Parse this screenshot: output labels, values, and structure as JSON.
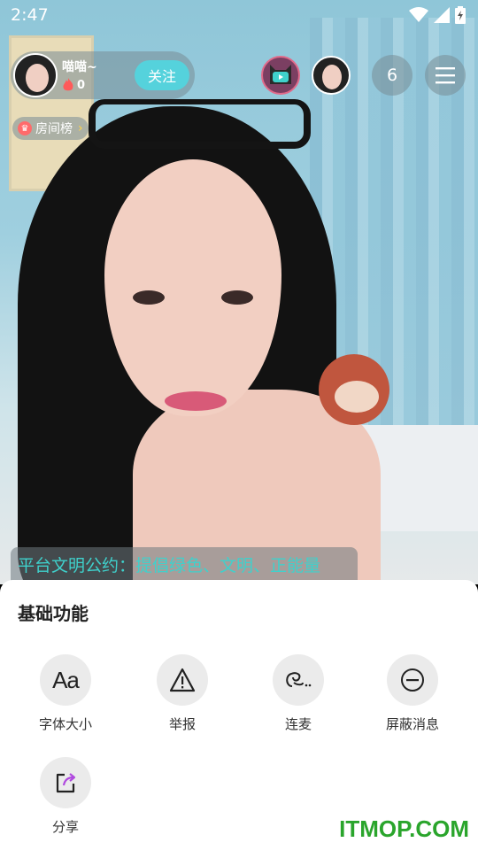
{
  "status_bar": {
    "time": "2:47"
  },
  "host": {
    "name": "喵喵~",
    "heat": "0",
    "follow_label": "关注"
  },
  "viewers": {
    "count": "6"
  },
  "rank": {
    "label": "房间榜"
  },
  "notice": {
    "text": "平台文明公约：提倡绿色、文明、正能量"
  },
  "sheet": {
    "title": "基础功能",
    "items": [
      {
        "label": "字体大小",
        "icon": "font-size-icon",
        "glyph": "Aa"
      },
      {
        "label": "举报",
        "icon": "warning-icon"
      },
      {
        "label": "连麦",
        "icon": "link-mic-icon"
      },
      {
        "label": "屏蔽消息",
        "icon": "block-icon"
      },
      {
        "label": "分享",
        "icon": "share-icon"
      }
    ]
  },
  "watermark": "ITMOP.COM",
  "colors": {
    "accent": "#55d2dc",
    "notice_text": "#3fd1cc",
    "watermark": "#2aa52c",
    "share_arrow": "#b04adf"
  }
}
